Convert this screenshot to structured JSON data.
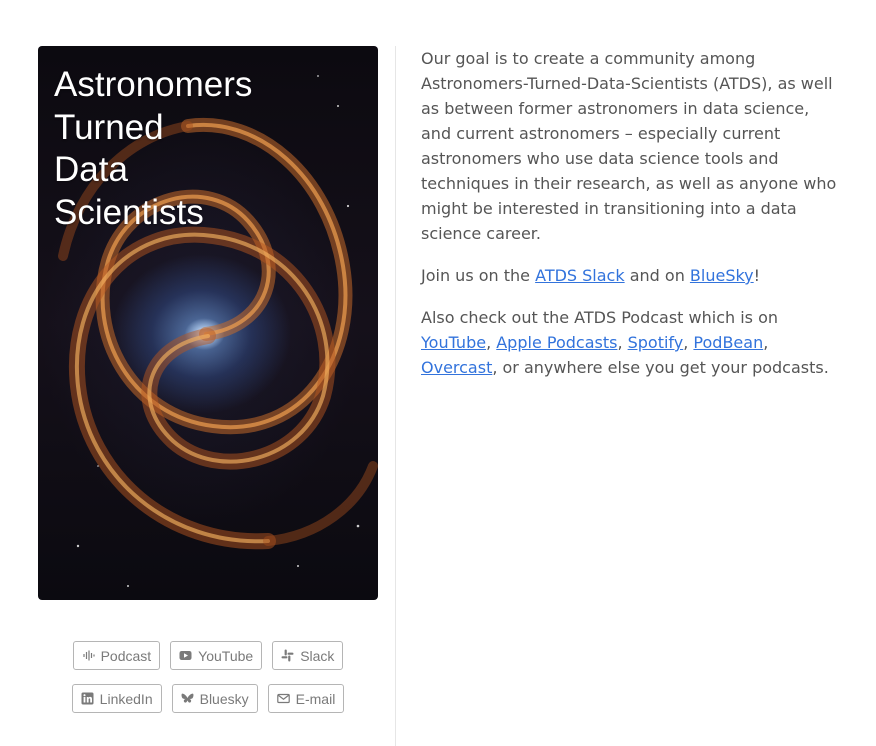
{
  "hero": {
    "title": "Astronomers\nTurned\nData\nScientists"
  },
  "buttons": {
    "podcast": "Podcast",
    "youtube": "YouTube",
    "slack": "Slack",
    "linkedin": "LinkedIn",
    "bluesky": "Bluesky",
    "email": "E-mail"
  },
  "intro": {
    "paragraph": "Our goal is to create a community among Astronomers-Turned-Data-Scientists (ATDS), as well as between former astronomers in data science, and current astronomers – especially current astronomers who use data science tools and techniques in their research, as well as anyone who might be interested in transitioning into a data science career."
  },
  "join": {
    "prefix": "Join us on the ",
    "slack_link": "ATDS Slack",
    "middle": " and on ",
    "bluesky_link": "BlueSky",
    "suffix": "!"
  },
  "podcast_info": {
    "prefix": "Also check out the ATDS Podcast which is on ",
    "youtube_link": "YouTube",
    "apple_link": "Apple Podcasts",
    "spotify_link": "Spotify",
    "podbean_link": "PodBean",
    "overcast_link": "Overcast",
    "sep": ", ",
    "suffix": ", or anywhere else you get your podcasts."
  },
  "colors": {
    "link": "#3273dc",
    "text": "#555555",
    "button_border": "#b5b5b5"
  }
}
